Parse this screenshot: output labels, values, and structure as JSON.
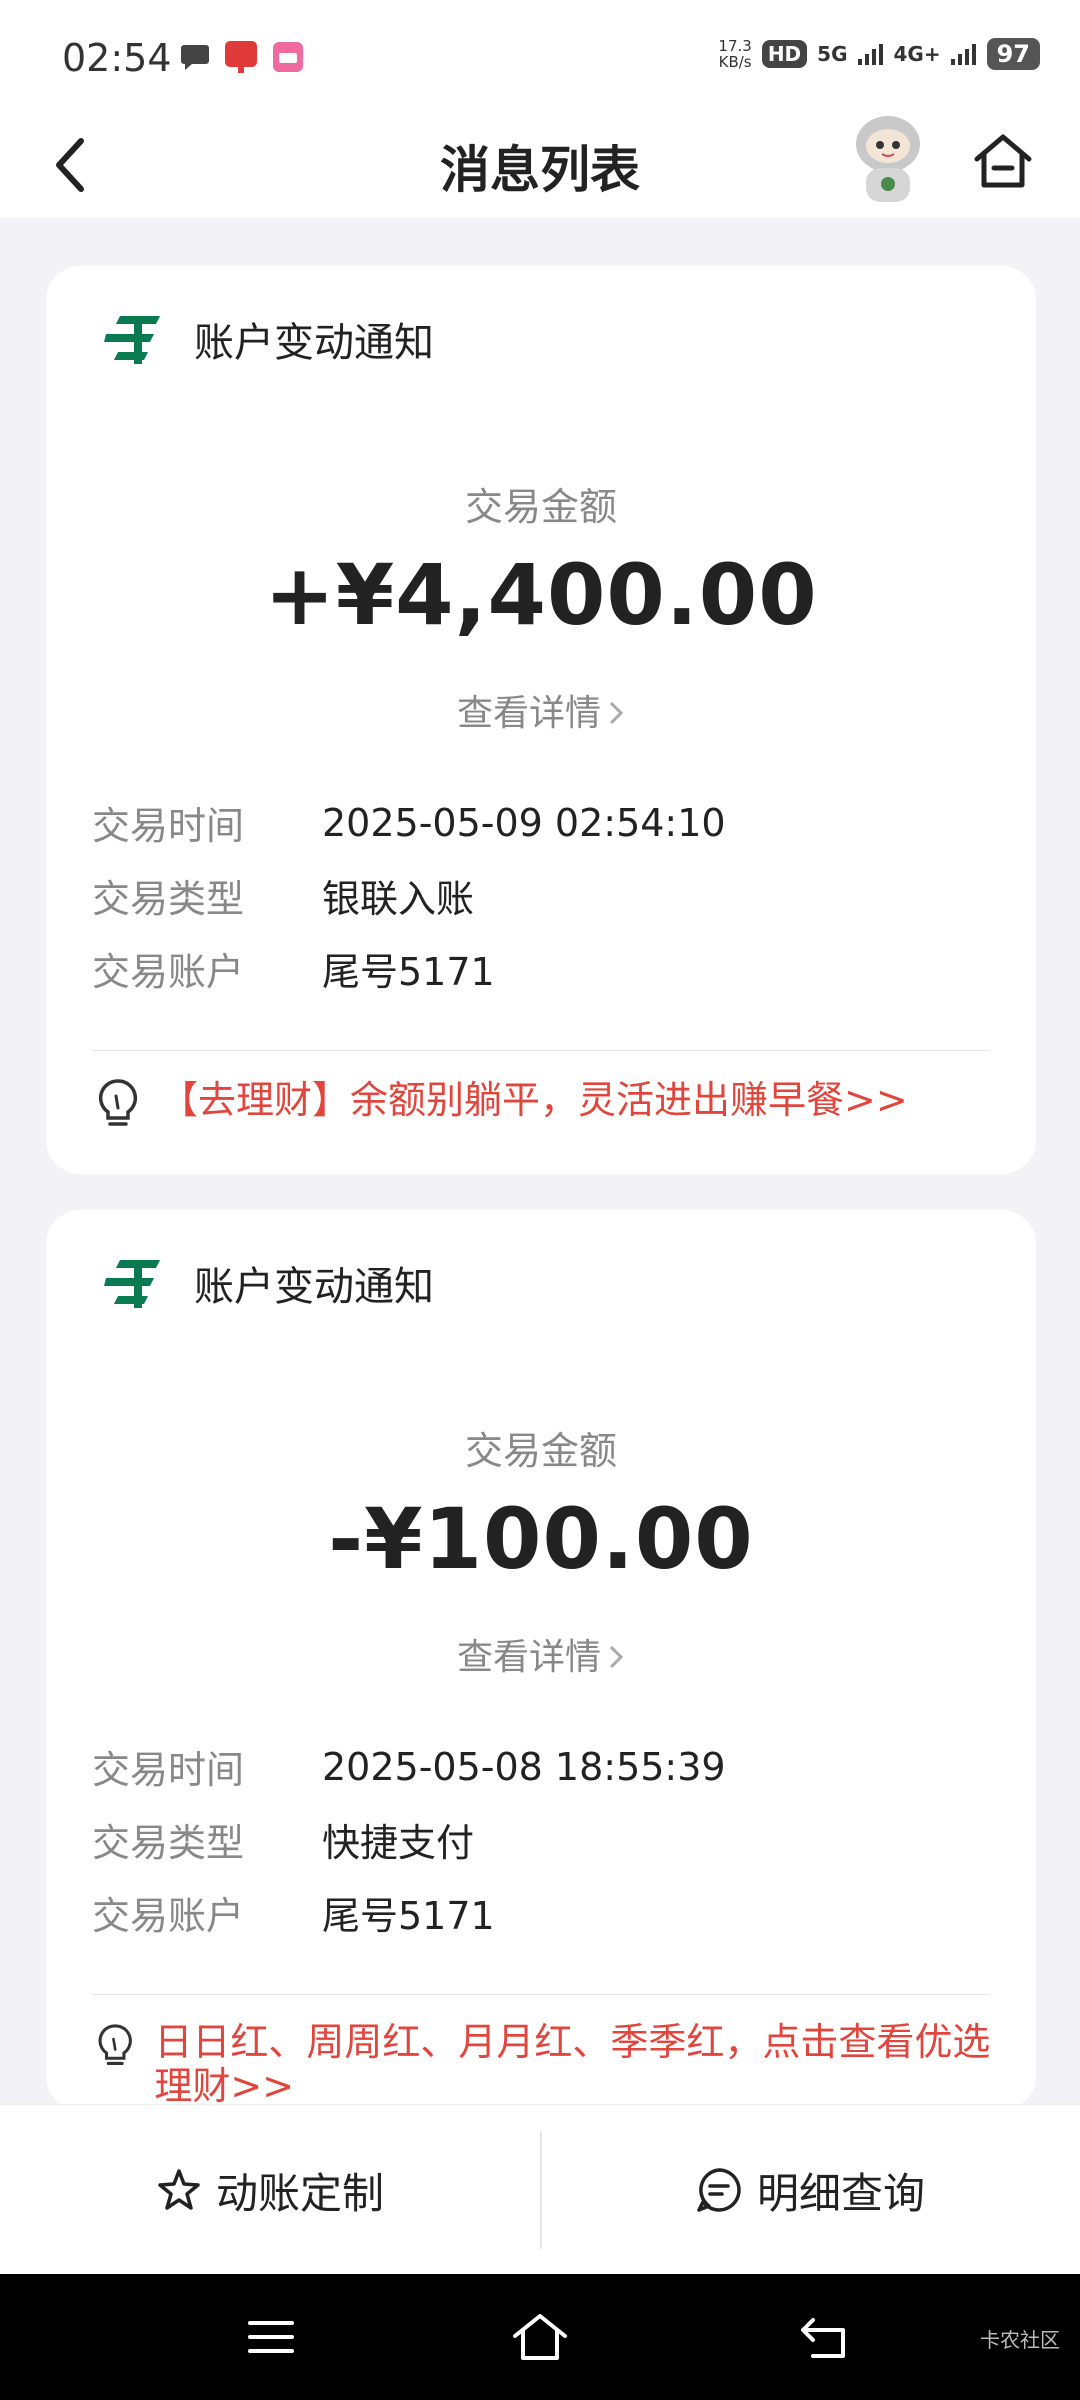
{
  "status_bar": {
    "time": "02:54",
    "net_speed_value": "17.3",
    "net_speed_unit": "KB/s",
    "hd_label": "HD",
    "signal_5g": "5G",
    "signal_4g": "4G+",
    "battery": "97"
  },
  "header": {
    "title": "消息列表"
  },
  "messages": [
    {
      "title": "账户变动通知",
      "amount_label": "交易金额",
      "amount": "+¥4,400.00",
      "details_link": "查看详情",
      "rows": [
        {
          "label": "交易时间",
          "value": "2025-05-09 02:54:10"
        },
        {
          "label": "交易类型",
          "value": "银联入账"
        },
        {
          "label": "交易账户",
          "value": "尾号5171"
        }
      ],
      "promo": "【去理财】余额别躺平，灵活进出赚早餐>>"
    },
    {
      "title": "账户变动通知",
      "amount_label": "交易金额",
      "amount": "-¥100.00",
      "details_link": "查看详情",
      "rows": [
        {
          "label": "交易时间",
          "value": "2025-05-08 18:55:39"
        },
        {
          "label": "交易类型",
          "value": "快捷支付"
        },
        {
          "label": "交易账户",
          "value": "尾号5171"
        }
      ],
      "promo": "日日红、周周红、月月红、季季红，点击查看优选理财>>"
    }
  ],
  "bottom_bar": {
    "left_label": "动账定制",
    "right_label": "明细查询"
  },
  "watermark": "卡农社区",
  "colors": {
    "brand_green": "#0a7a50",
    "promo_red": "#e0463e"
  }
}
